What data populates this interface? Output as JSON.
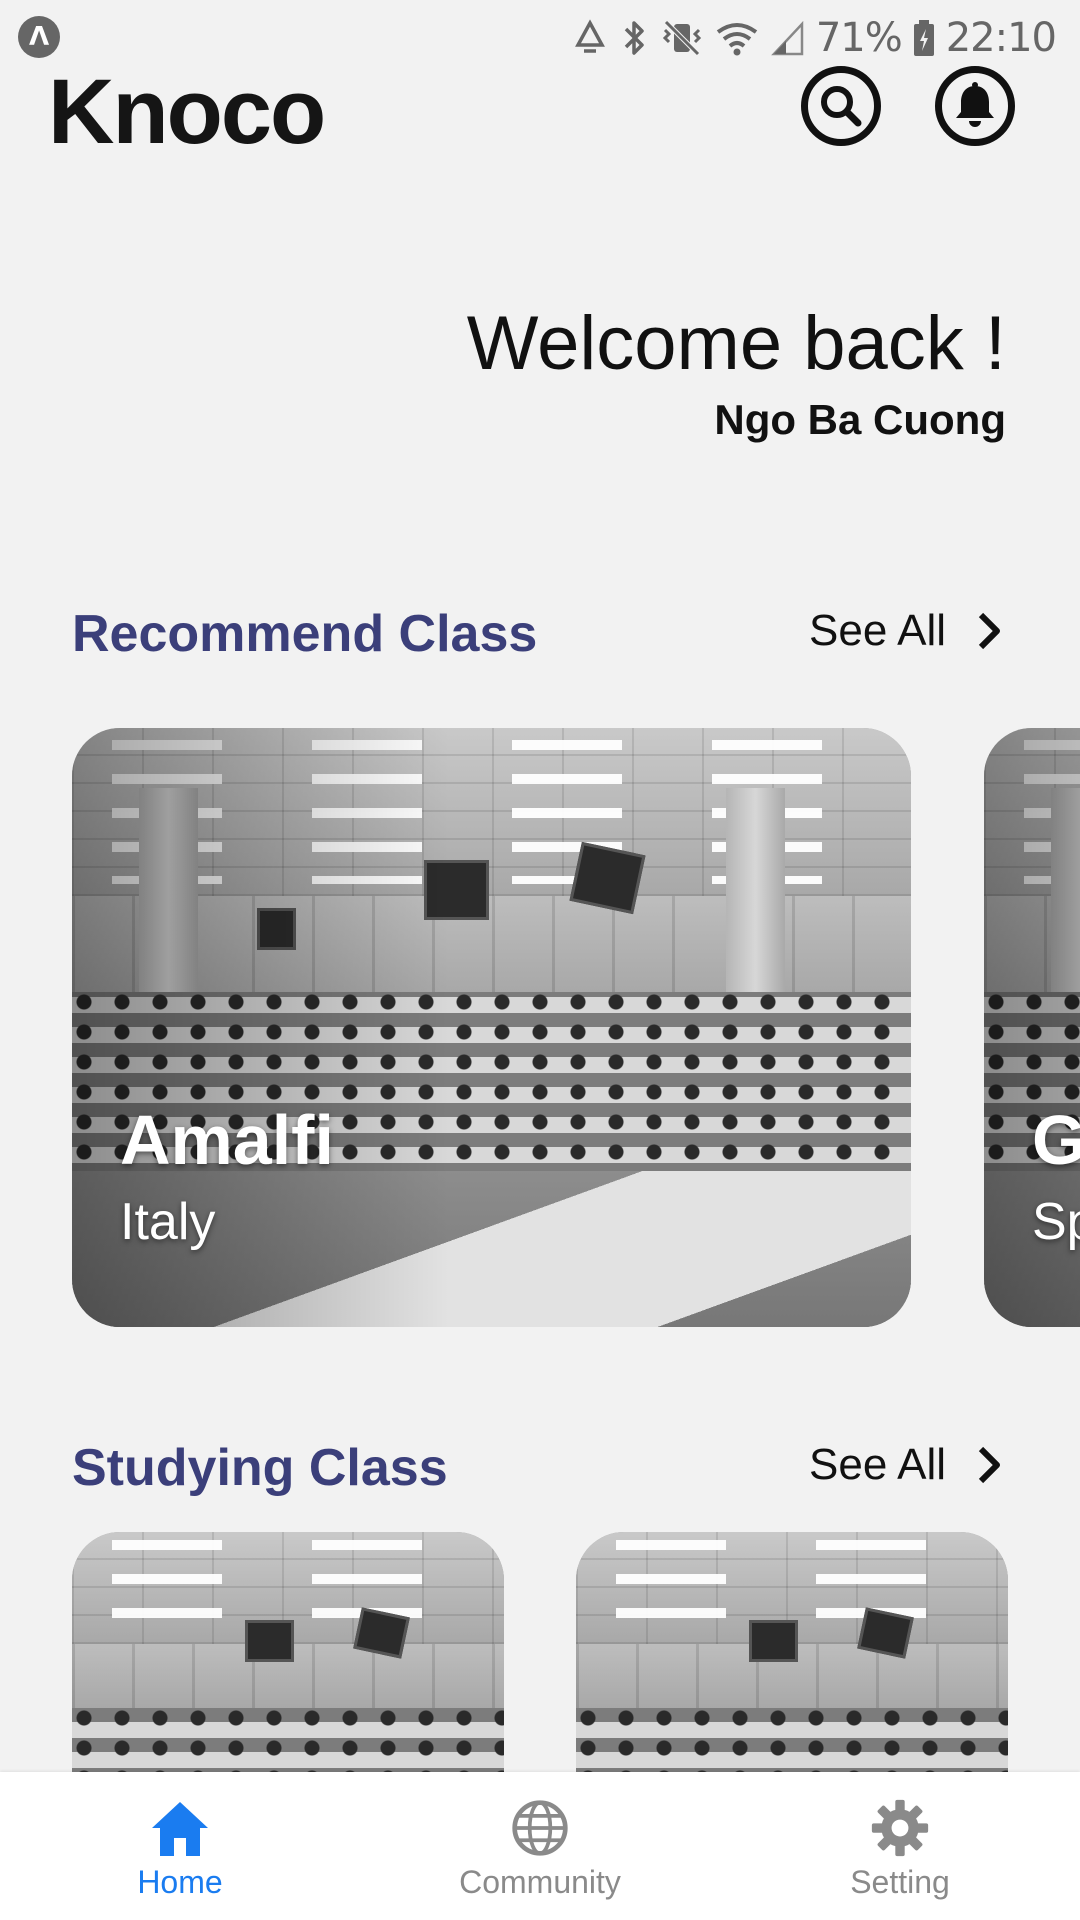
{
  "status_bar": {
    "battery": "71%",
    "time": "22:10"
  },
  "header": {
    "app_title": "Knoco",
    "search_icon": "search-icon",
    "bell_icon": "bell-icon"
  },
  "welcome": {
    "title": "Welcome back !",
    "user_name": "Ngo Ba Cuong"
  },
  "recommend": {
    "title": "Recommend Class",
    "see_all": "See All",
    "cards": [
      {
        "name": "Amalfi",
        "country": "Italy"
      },
      {
        "name": "G",
        "country": "Sp"
      }
    ]
  },
  "studying": {
    "title": "Studying Class",
    "see_all": "See All"
  },
  "bottom_nav": {
    "items": [
      {
        "label": "Home",
        "icon": "home-icon",
        "active": true
      },
      {
        "label": "Community",
        "icon": "globe-icon",
        "active": false
      },
      {
        "label": "Setting",
        "icon": "gear-icon",
        "active": false
      }
    ]
  },
  "colors": {
    "background": "#f2f2f2",
    "section_title": "#3b3f7a",
    "nav_active": "#1a7cf0",
    "nav_inactive": "#8a8a8a",
    "status_gray": "#666666"
  }
}
